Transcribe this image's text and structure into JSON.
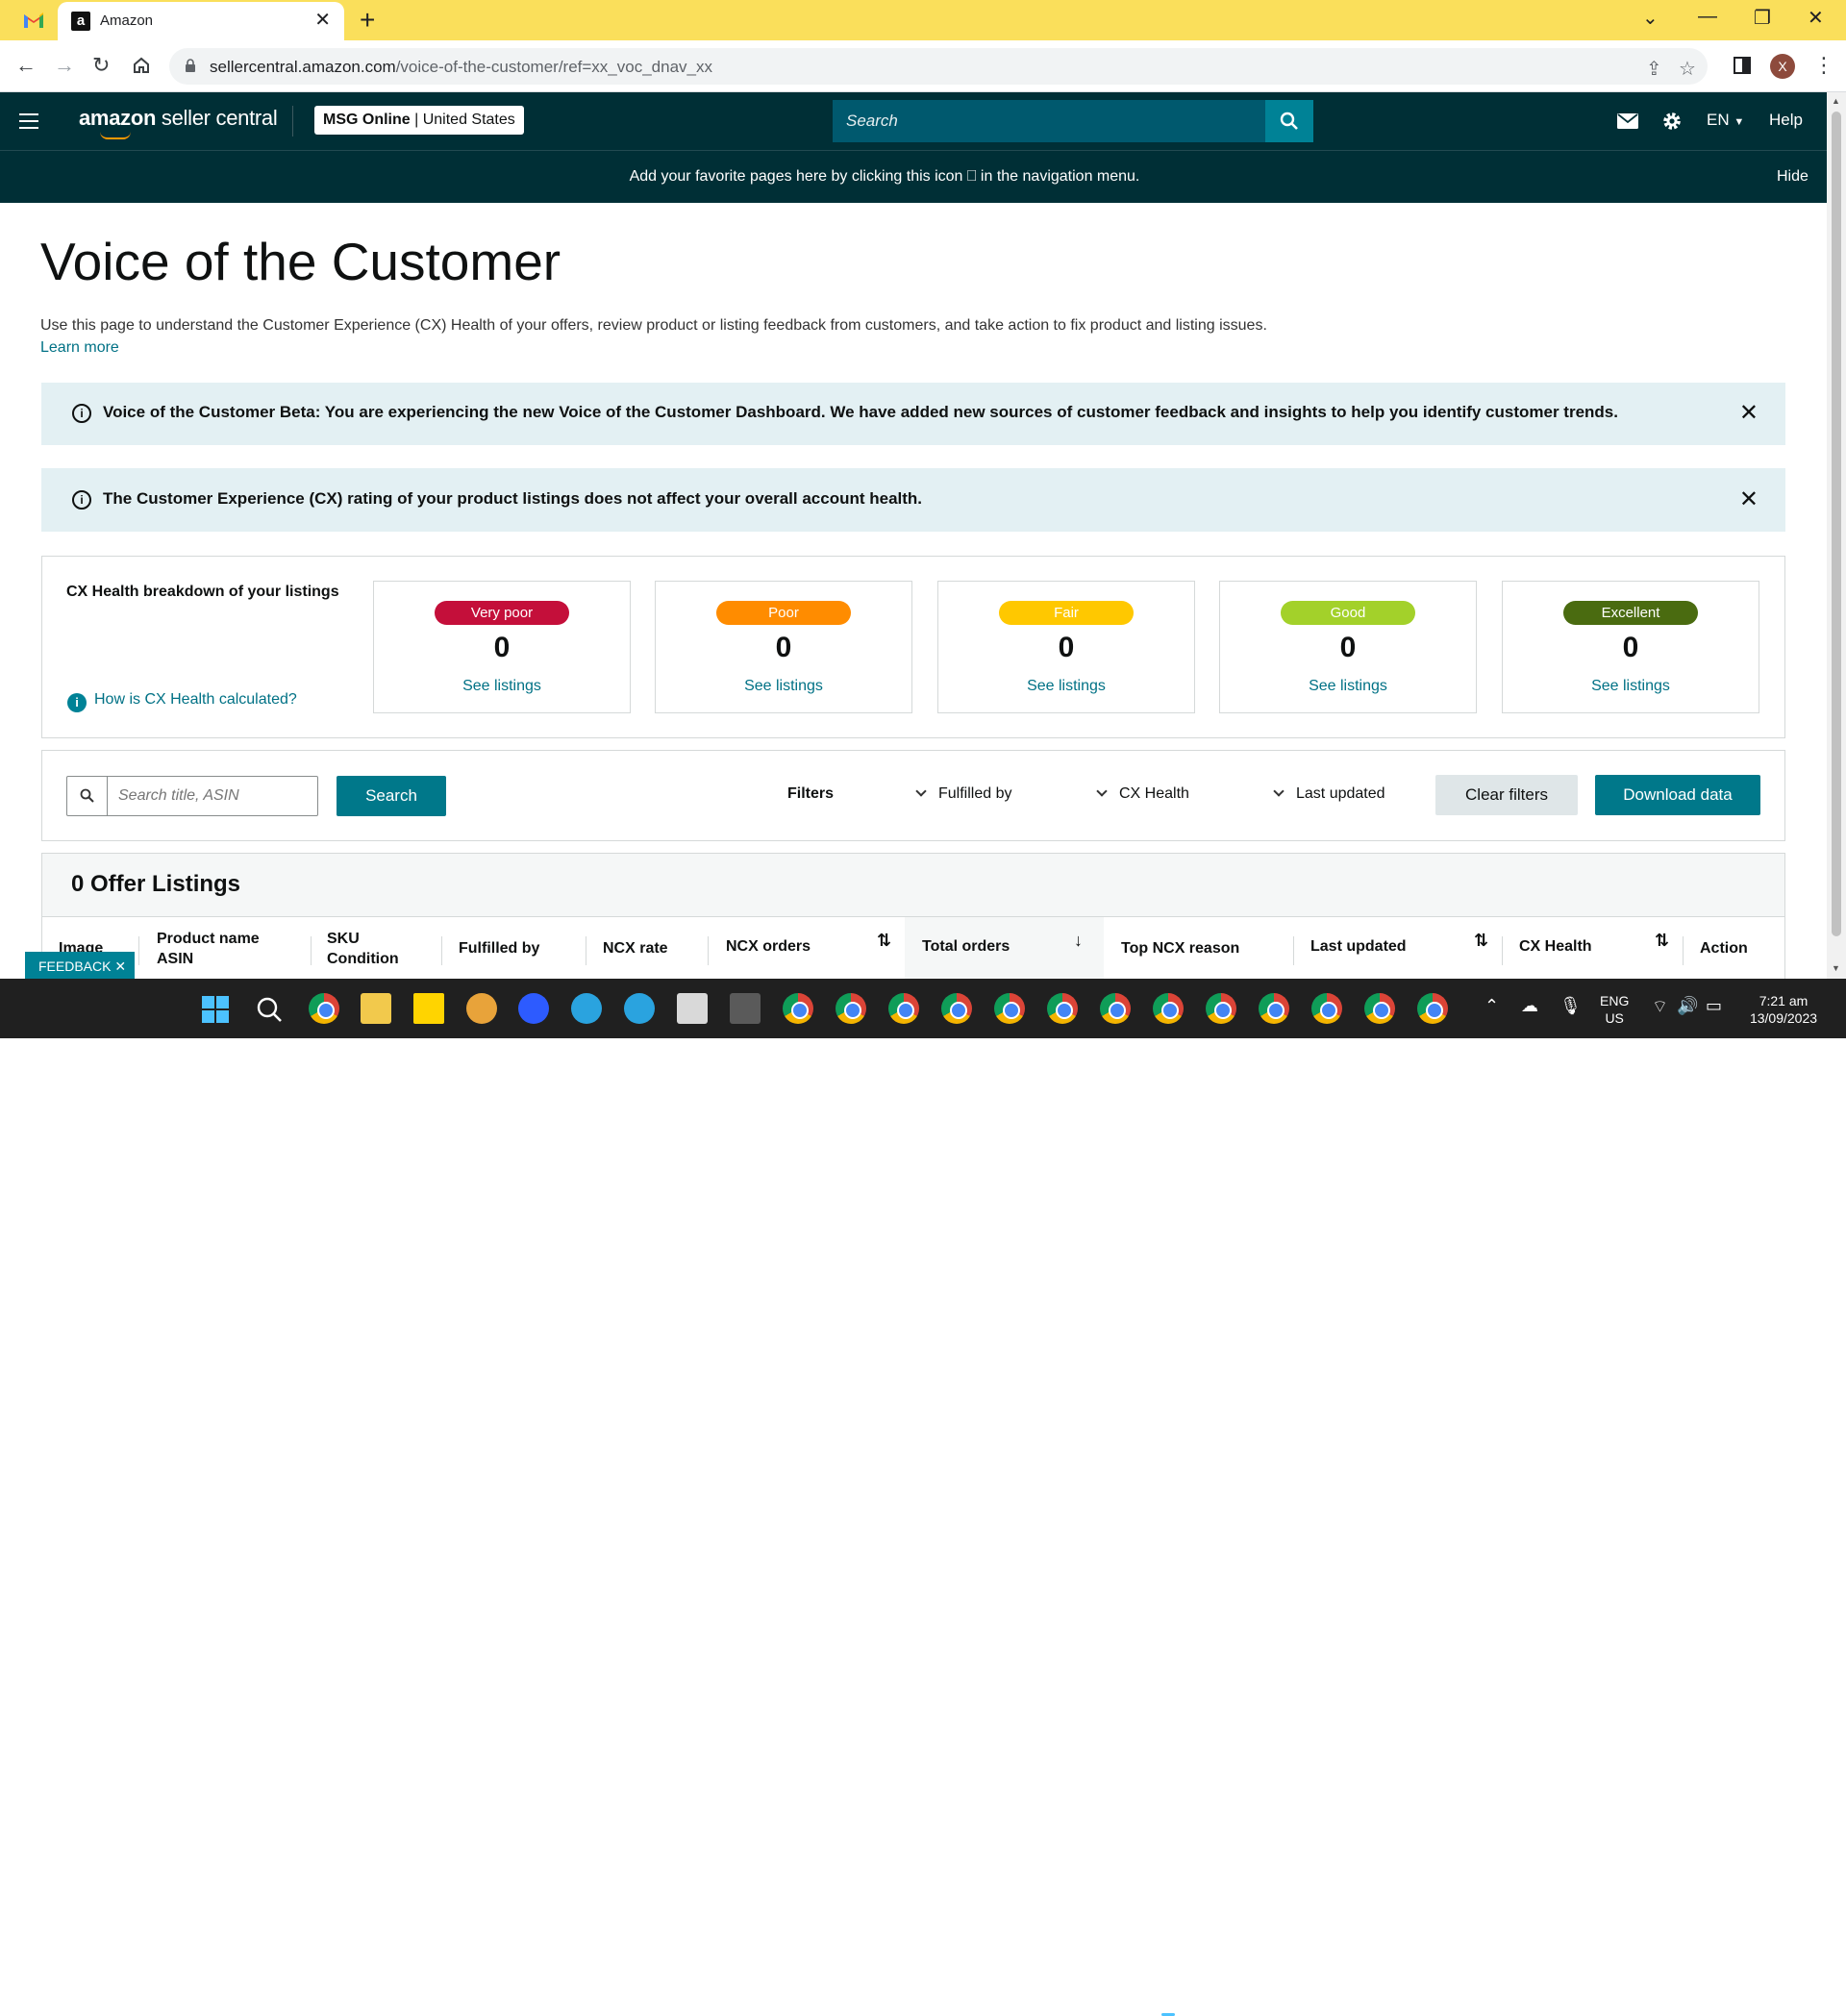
{
  "browser": {
    "tab_title": "Amazon",
    "tab_favicon": "a",
    "url_host": "sellercentral.amazon.com",
    "url_path": "/voice-of-the-customer/ref=xx_voc_dnav_xx",
    "profile_initial": "X"
  },
  "header": {
    "logo_bold": "amazon",
    "logo_rest": " seller central",
    "store_name": "MSG Online",
    "store_country": " | United States",
    "search_placeholder": "Search",
    "language": "EN",
    "help": "Help"
  },
  "favorites_banner": {
    "message": "Add your favorite pages here by clicking this icon ⎕ in the navigation menu.",
    "hide": "Hide"
  },
  "page": {
    "title": "Voice of the Customer",
    "description": "Use this page to understand the Customer Experience (CX) Health of your offers, review product or listing feedback from customers, and take action to fix product and listing issues.",
    "learn_more": "Learn more"
  },
  "alerts": [
    {
      "text": "Voice of the Customer Beta: You are experiencing the new Voice of the Customer Dashboard. We have added new sources of customer feedback and insights to help you identify customer trends."
    },
    {
      "text": "The Customer Experience (CX) rating of your product listings does not affect your overall account health."
    }
  ],
  "cx_health": {
    "title": "CX Health breakdown of your listings",
    "how_link": "How is CX Health calculated?",
    "cards": [
      {
        "label": "Very poor",
        "count": "0",
        "link": "See listings",
        "color": "#c40f3a"
      },
      {
        "label": "Poor",
        "count": "0",
        "link": "See listings",
        "color": "#ff8c00"
      },
      {
        "label": "Fair",
        "count": "0",
        "link": "See listings",
        "color": "#ffc800"
      },
      {
        "label": "Good",
        "count": "0",
        "link": "See listings",
        "color": "#a3d12a"
      },
      {
        "label": "Excellent",
        "count": "0",
        "link": "See listings",
        "color": "#4a6b10"
      }
    ]
  },
  "filters": {
    "search_placeholder": "Search title, ASIN",
    "search_button": "Search",
    "label": "Filters",
    "fulfilled_by": "Fulfilled by",
    "cx_health": "CX Health",
    "last_updated": "Last updated",
    "clear": "Clear filters",
    "download": "Download data"
  },
  "listings": {
    "title": "0 Offer Listings",
    "columns": {
      "image": "Image",
      "product_name": "Product name",
      "asin": "ASIN",
      "sku": "SKU",
      "condition": "Condition",
      "fulfilled_by": "Fulfilled by",
      "ncx_rate": "NCX rate",
      "ncx_orders": "NCX orders",
      "total_orders": "Total orders",
      "top_ncx_reason": "Top NCX reason",
      "last_updated": "Last updated",
      "cx_health": "CX Health",
      "action": "Action"
    }
  },
  "feedback": "FEEDBACK ✕",
  "taskbar": {
    "lang_line1": "ENG",
    "lang_line2": "US",
    "time": "7:21 am",
    "date": "13/09/2023"
  }
}
